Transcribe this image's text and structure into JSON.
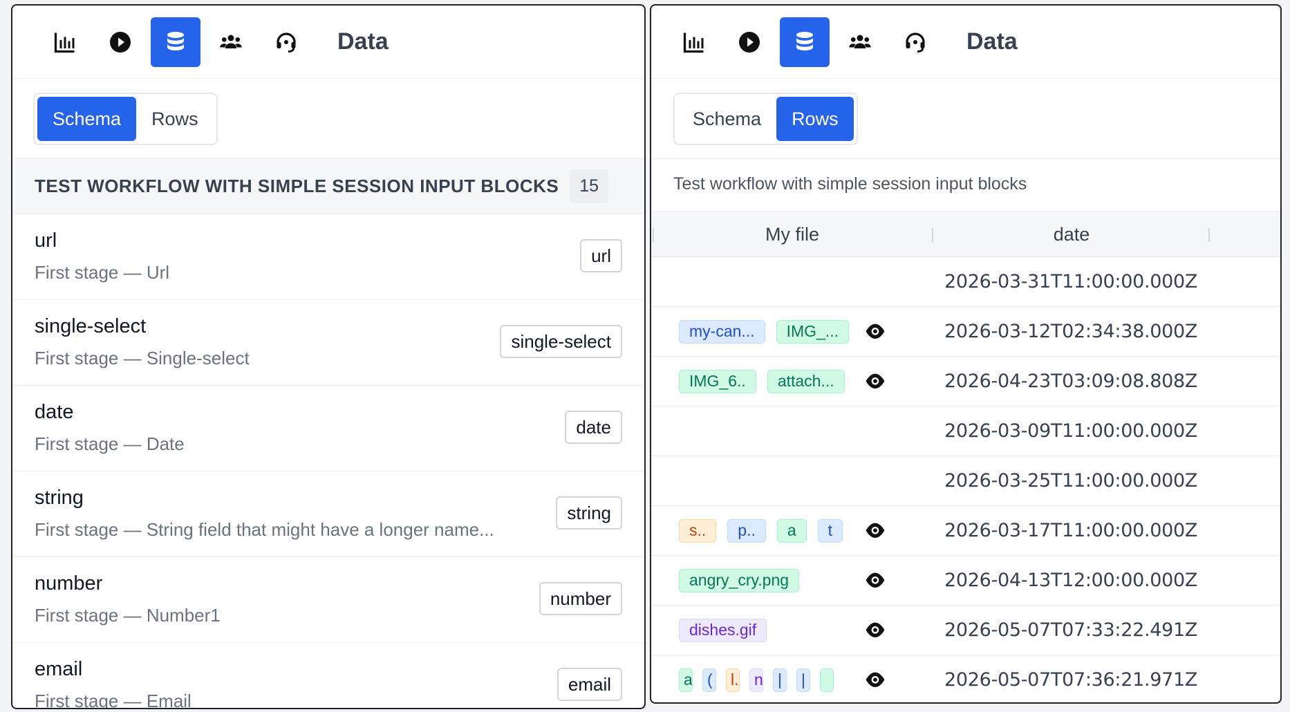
{
  "colors": {
    "accent": "#2563eb"
  },
  "left": {
    "toolbar": {
      "icons": [
        "bar-chart-icon",
        "play-icon",
        "database-icon",
        "users-icon",
        "headset-icon"
      ],
      "title": "Data"
    },
    "tabs": {
      "schema": "Schema",
      "rows": "Rows",
      "active": "Schema"
    },
    "group": {
      "title": "TEST WORKFLOW WITH SIMPLE SESSION INPUT BLOCKS",
      "count": "15"
    },
    "fields": [
      {
        "name": "url",
        "desc": "First stage — Url",
        "type": "url"
      },
      {
        "name": "single-select",
        "desc": "First stage — Single-select",
        "type": "single-select"
      },
      {
        "name": "date",
        "desc": "First stage — Date",
        "type": "date"
      },
      {
        "name": "string",
        "desc": "First stage — String field that might have a longer name...",
        "type": "string"
      },
      {
        "name": "number",
        "desc": "First stage — Number1",
        "type": "number"
      },
      {
        "name": "email",
        "desc": "First stage — Email",
        "type": "email"
      }
    ]
  },
  "right": {
    "toolbar": {
      "title": "Data"
    },
    "tabs": {
      "schema": "Schema",
      "rows": "Rows",
      "active": "Rows"
    },
    "workflow_label": "Test workflow with simple session input blocks",
    "columns": {
      "file": "My file",
      "date": "date"
    },
    "rows": [
      {
        "files": [],
        "eye": false,
        "date": "2026-03-31T11:00:00.000Z"
      },
      {
        "files": [
          {
            "label": "my-can...",
            "color": "blue"
          },
          {
            "label": "IMG_...",
            "color": "green"
          }
        ],
        "eye": true,
        "date": "2026-03-12T02:34:38.000Z"
      },
      {
        "files": [
          {
            "label": "IMG_6..",
            "color": "green"
          },
          {
            "label": "attach...",
            "color": "green"
          }
        ],
        "eye": true,
        "date": "2026-04-23T03:09:08.808Z"
      },
      {
        "files": [],
        "eye": false,
        "date": "2026-03-09T11:00:00.000Z"
      },
      {
        "files": [],
        "eye": false,
        "date": "2026-03-25T11:00:00.000Z"
      },
      {
        "files": [
          {
            "label": "s..",
            "color": "orange"
          },
          {
            "label": "p..",
            "color": "blue"
          },
          {
            "label": "a",
            "color": "green"
          },
          {
            "label": "t",
            "color": "blue"
          }
        ],
        "eye": true,
        "date": "2026-03-17T11:00:00.000Z"
      },
      {
        "files": [
          {
            "label": "angry_cry.png",
            "color": "green"
          }
        ],
        "eye": true,
        "date": "2026-04-13T12:00:00.000Z"
      },
      {
        "files": [
          {
            "label": "dishes.gif",
            "color": "purple"
          }
        ],
        "eye": true,
        "date": "2026-05-07T07:33:22.491Z"
      },
      {
        "files": [
          {
            "label": "a",
            "color": "green",
            "tiny": true
          },
          {
            "label": "(",
            "color": "blue",
            "tiny": true
          },
          {
            "label": "l.",
            "color": "orange",
            "tiny": true
          },
          {
            "label": "n",
            "color": "purple",
            "tiny": true
          },
          {
            "label": "|",
            "color": "blue",
            "tiny": true
          },
          {
            "label": "|",
            "color": "blue",
            "tiny": true
          },
          {
            "label": "",
            "color": "green",
            "tiny": true
          }
        ],
        "eye": true,
        "date": "2026-05-07T07:36:21.971Z"
      }
    ]
  }
}
